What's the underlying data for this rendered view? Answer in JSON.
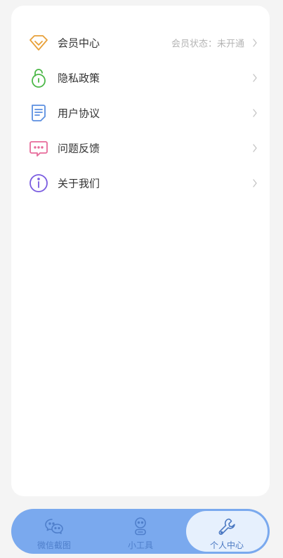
{
  "menu": {
    "items": [
      {
        "icon": "diamond-icon",
        "label": "会员中心",
        "value": "会员状态：未开通",
        "color": "#e8a13a"
      },
      {
        "icon": "lock-icon",
        "label": "隐私政策",
        "value": "",
        "color": "#4cb848"
      },
      {
        "icon": "document-icon",
        "label": "用户协议",
        "value": "",
        "color": "#5b8fe0"
      },
      {
        "icon": "message-icon",
        "label": "问题反馈",
        "value": "",
        "color": "#e76b9a"
      },
      {
        "icon": "info-icon",
        "label": "关于我们",
        "value": "",
        "color": "#7a5ce0"
      }
    ]
  },
  "tabbar": {
    "background": "#7aa9ee",
    "active_index": 2,
    "tabs": [
      {
        "icon": "wechat-icon",
        "label": "微信截图"
      },
      {
        "icon": "robot-icon",
        "label": "小工具"
      },
      {
        "icon": "wrench-icon",
        "label": "个人中心"
      }
    ]
  }
}
